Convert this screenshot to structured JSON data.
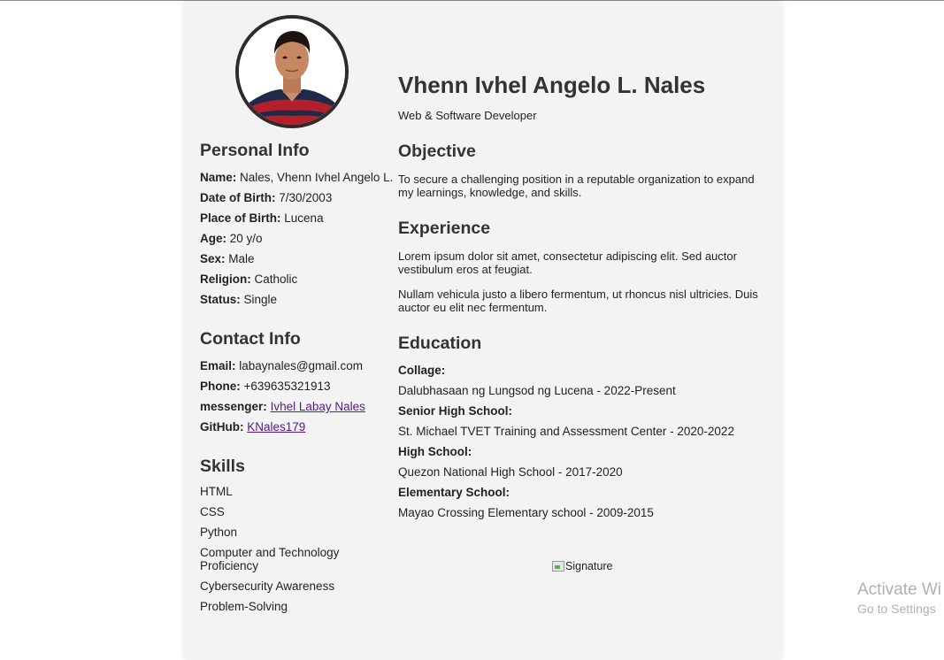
{
  "header": {
    "name": "Vhenn Ivhel Angelo L. Nales",
    "title": "Web & Software Developer"
  },
  "personal_info": {
    "heading": "Personal Info",
    "rows": [
      {
        "label": "Name:",
        "value": "Nales, Vhenn Ivhel Angelo L."
      },
      {
        "label": "Date of Birth:",
        "value": "7/30/2003"
      },
      {
        "label": "Place of Birth:",
        "value": "Lucena"
      },
      {
        "label": "Age:",
        "value": "20 y/o"
      },
      {
        "label": "Sex:",
        "value": "Male"
      },
      {
        "label": "Religion:",
        "value": "Catholic"
      },
      {
        "label": "Status:",
        "value": "Single"
      }
    ]
  },
  "contact_info": {
    "heading": "Contact Info",
    "email_label": "Email:",
    "email": "labaynales@gmail.com",
    "phone_label": "Phone:",
    "phone": "+639635321913",
    "messenger_label": "messenger:",
    "messenger": "Ivhel Labay Nales",
    "github_label": "GitHub:",
    "github": "KNales179"
  },
  "skills": {
    "heading": "Skills",
    "items": [
      "HTML",
      "CSS",
      "Python",
      "Computer and Technology Proficiency",
      "Cybersecurity Awareness",
      "Problem-Solving"
    ]
  },
  "objective": {
    "heading": "Objective",
    "text": "To secure a challenging position in a reputable organization to expand my learnings, knowledge, and skills."
  },
  "experience": {
    "heading": "Experience",
    "paragraphs": [
      "Lorem ipsum dolor sit amet, consectetur adipiscing elit. Sed auctor vestibulum eros at feugiat.",
      "Nullam vehicula justo a libero fermentum, ut rhoncus nisl ultricies. Duis auctor eu elit nec fermentum."
    ]
  },
  "education": {
    "heading": "Education",
    "entries": [
      {
        "label": "Collage:",
        "value": "Dalubhasaan ng Lungsod ng Lucena - 2022-Present"
      },
      {
        "label": "Senior High School:",
        "value": "St. Michael TVET Training and Assessment Center - 2020-2022"
      },
      {
        "label": "High School:",
        "value": "Quezon National High School - 2017-2020"
      },
      {
        "label": "Elementary School:",
        "value": "Mayao Crossing Elementary school - 2009-2015"
      }
    ]
  },
  "signature": {
    "alt": "Signature"
  },
  "watermark": {
    "line1": "Activate Wi",
    "line2": "Go to Settings"
  },
  "colors": {
    "card_bg": "#f3f3f3",
    "heading": "#333333",
    "link": "#551a8b"
  }
}
